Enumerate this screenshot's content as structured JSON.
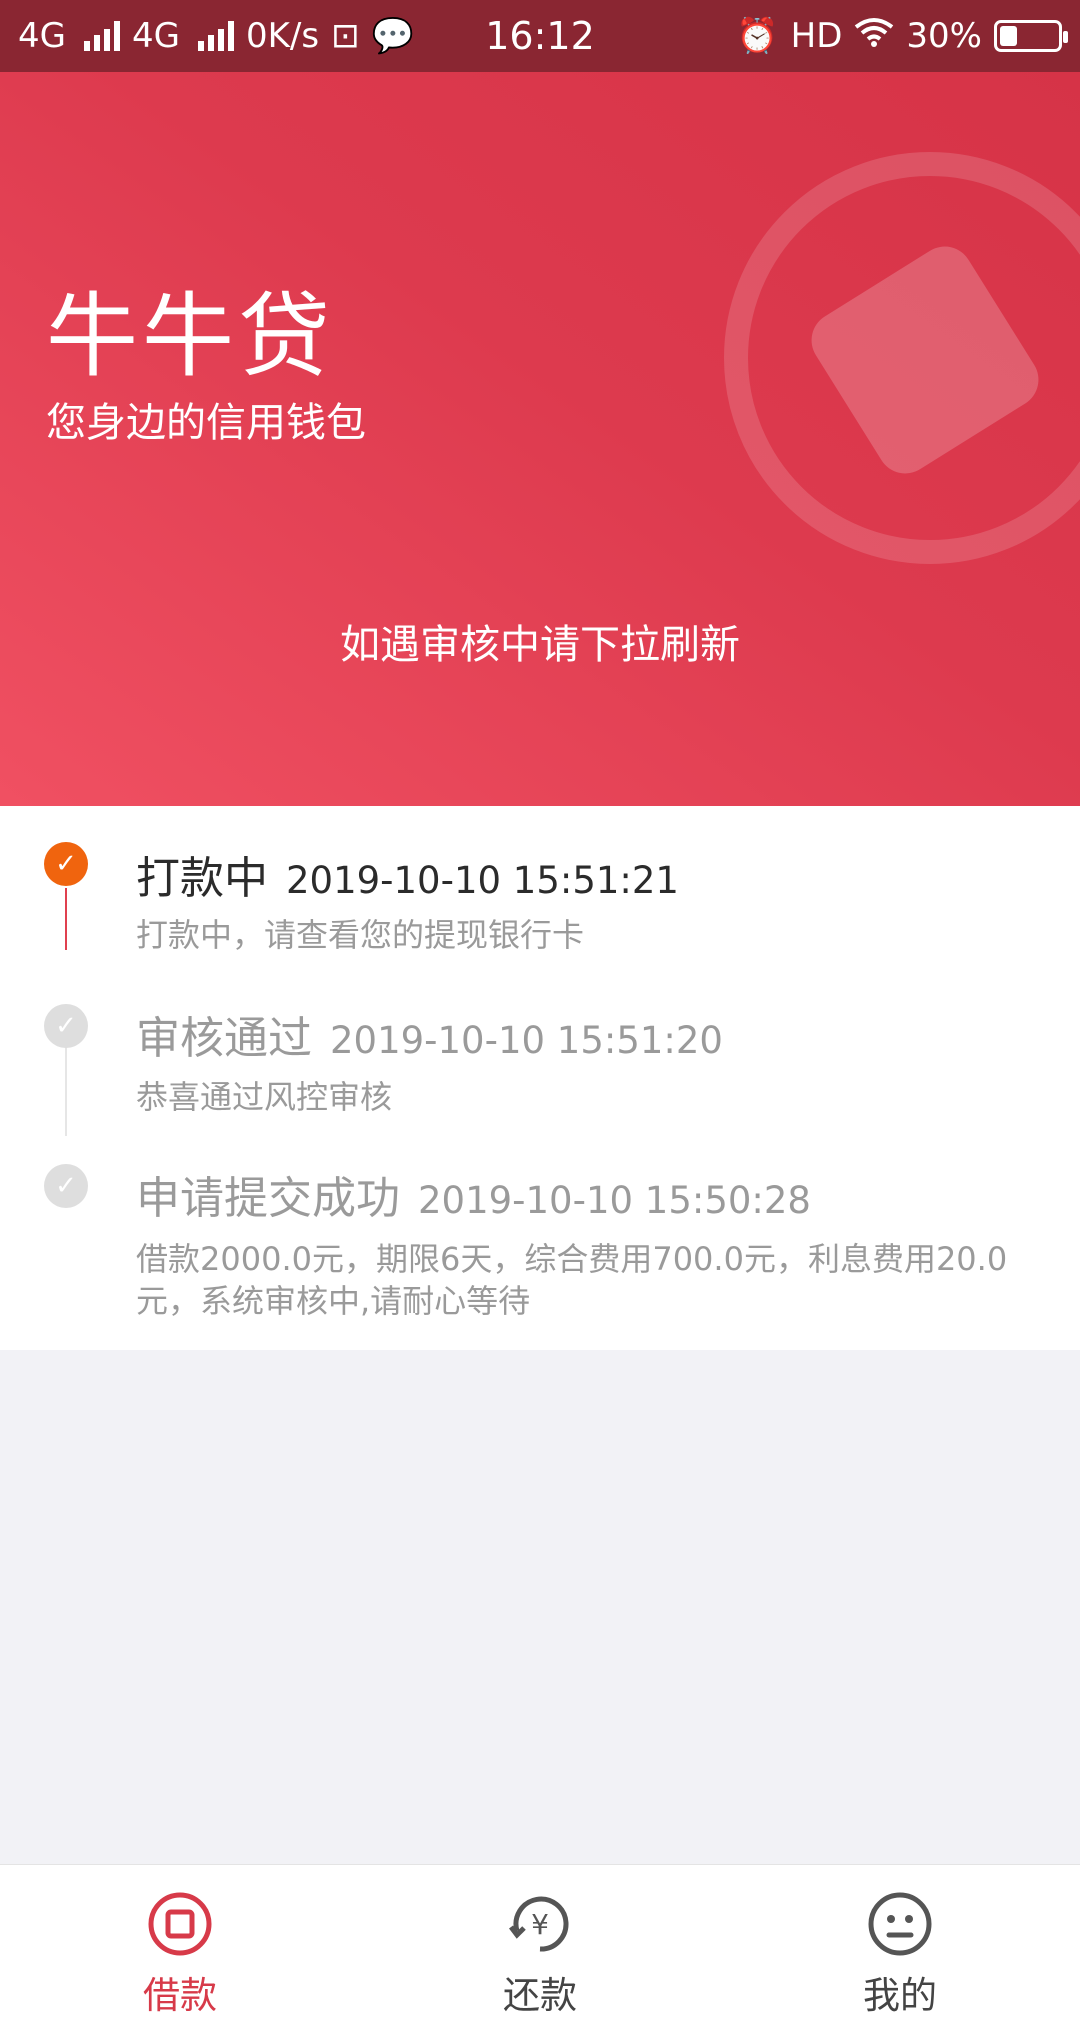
{
  "status_bar": {
    "net1": "4G",
    "net2": "4G",
    "speed": "0K/s",
    "time": "16:12",
    "hd": "HD",
    "battery": "30%",
    "battery_level": 0.3
  },
  "hero": {
    "title": "牛牛贷",
    "subtitle": "您身边的信用钱包",
    "refresh_tip": "如遇审核中请下拉刷新"
  },
  "timeline": [
    {
      "title": "打款中",
      "time": "2019-10-10 15:51:21",
      "desc": "打款中，请查看您的提现银行卡",
      "state": "active"
    },
    {
      "title": "审核通过",
      "time": "2019-10-10 15:51:20",
      "desc": "恭喜通过风控审核",
      "state": "done"
    },
    {
      "title": "申请提交成功",
      "time": "2019-10-10 15:50:28",
      "desc": "借款2000.0元，期限6天，综合费用700.0元，利息费用20.0元，系统审核中,请耐心等待",
      "state": "done"
    }
  ],
  "bottom_nav": [
    {
      "label": "借款",
      "icon": "loan-icon",
      "active": true
    },
    {
      "label": "还款",
      "icon": "repay-yen-icon",
      "active": false
    },
    {
      "label": "我的",
      "icon": "profile-face-icon",
      "active": false
    }
  ],
  "colors": {
    "status_bar": "#8a2632",
    "hero_red": "#dd3a4e",
    "active_orange": "#f0640e",
    "nav_active": "#d73a49"
  }
}
